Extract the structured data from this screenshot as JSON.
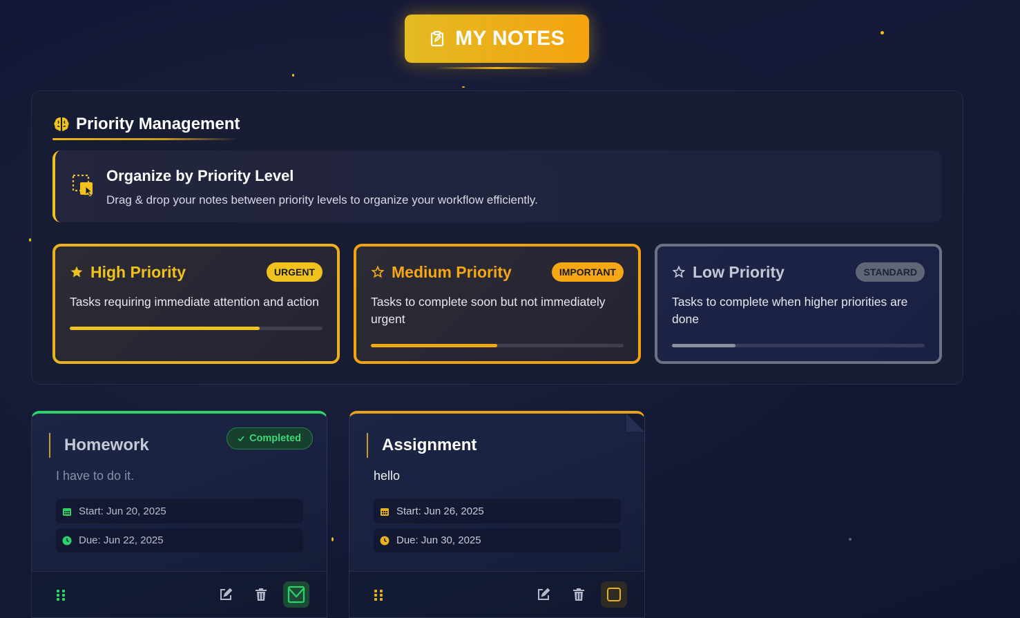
{
  "header": {
    "title": "MY NOTES",
    "icon": "clipboard-icon"
  },
  "panel": {
    "title": "Priority Management",
    "icon": "brain-icon",
    "info": {
      "icon": "drag-drop-icon",
      "title": "Organize by Priority Level",
      "description": "Drag & drop your notes between priority levels to organize your workflow efficiently."
    },
    "levels": [
      {
        "name": "High Priority",
        "badge": "URGENT",
        "description": "Tasks requiring immediate attention and action",
        "progress": 0.75,
        "color": "#f0c21e",
        "icon": "star-filled-icon"
      },
      {
        "name": "Medium Priority",
        "badge": "IMPORTANT",
        "description": "Tasks to complete soon but not immediately urgent",
        "progress": 0.5,
        "color": "#f5a714",
        "icon": "star-outline-icon"
      },
      {
        "name": "Low Priority",
        "badge": "STANDARD",
        "description": "Tasks to complete when higher priorities are done",
        "progress": 0.25,
        "color": "#8a909e",
        "icon": "star-outline-icon"
      }
    ]
  },
  "notes": [
    {
      "title": "Homework",
      "status": "Completed",
      "body": "I have to do it.",
      "start": "Start: Jun 20, 2025",
      "due": "Due: Jun 22, 2025",
      "accent": "#2bd46a",
      "checked": true
    },
    {
      "title": "Assignment",
      "status": "",
      "body": "hello",
      "start": "Start: Jun 26, 2025",
      "due": "Due: Jun 30, 2025",
      "accent": "#e8a21a",
      "checked": false
    }
  ]
}
